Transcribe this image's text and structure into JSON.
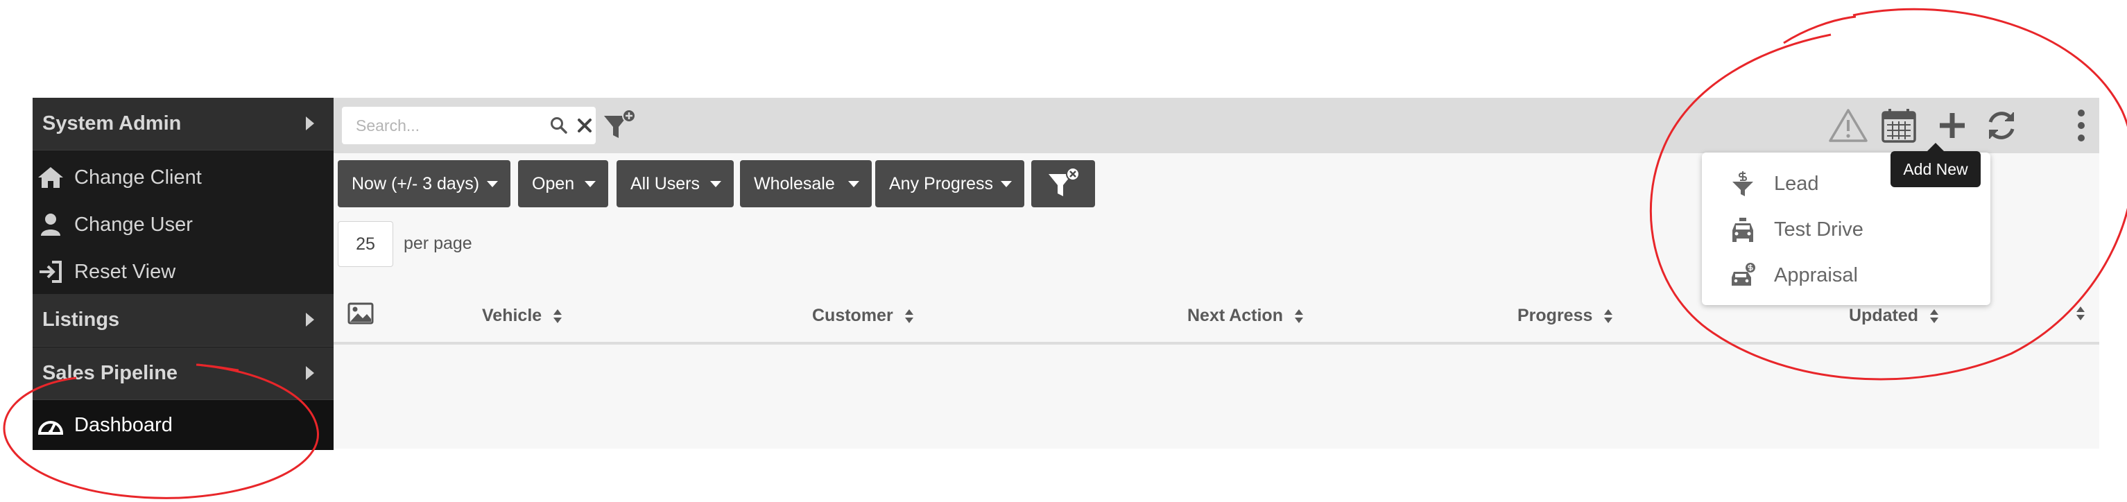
{
  "sidebar": {
    "system_admin": "System Admin",
    "change_client": "Change Client",
    "change_user": "Change User",
    "reset_view": "Reset View",
    "listings": "Listings",
    "sales_pipeline": "Sales Pipeline",
    "dashboard": "Dashboard"
  },
  "search": {
    "placeholder": "Search..."
  },
  "filters": {
    "date": "Now (+/- 3 days)",
    "status": "Open",
    "users": "All Users",
    "type": "Wholesale",
    "progress": "Any Progress"
  },
  "pagination": {
    "per_page_value": "25",
    "per_page_label": "per page"
  },
  "table": {
    "columns": [
      "Vehicle",
      "Customer",
      "Next Action",
      "Progress",
      "Updated"
    ]
  },
  "add_new_menu": {
    "tooltip": "Add New",
    "items": [
      "Lead",
      "Test Drive",
      "Appraisal"
    ]
  },
  "colors": {
    "sidebar_bg": "#1b1b1b",
    "sidebar_section_bg": "#2f2f2f",
    "filter_button_bg": "#4a4a4a",
    "topbar_bg": "#dcdcdc",
    "annotation": "#e8262a"
  }
}
